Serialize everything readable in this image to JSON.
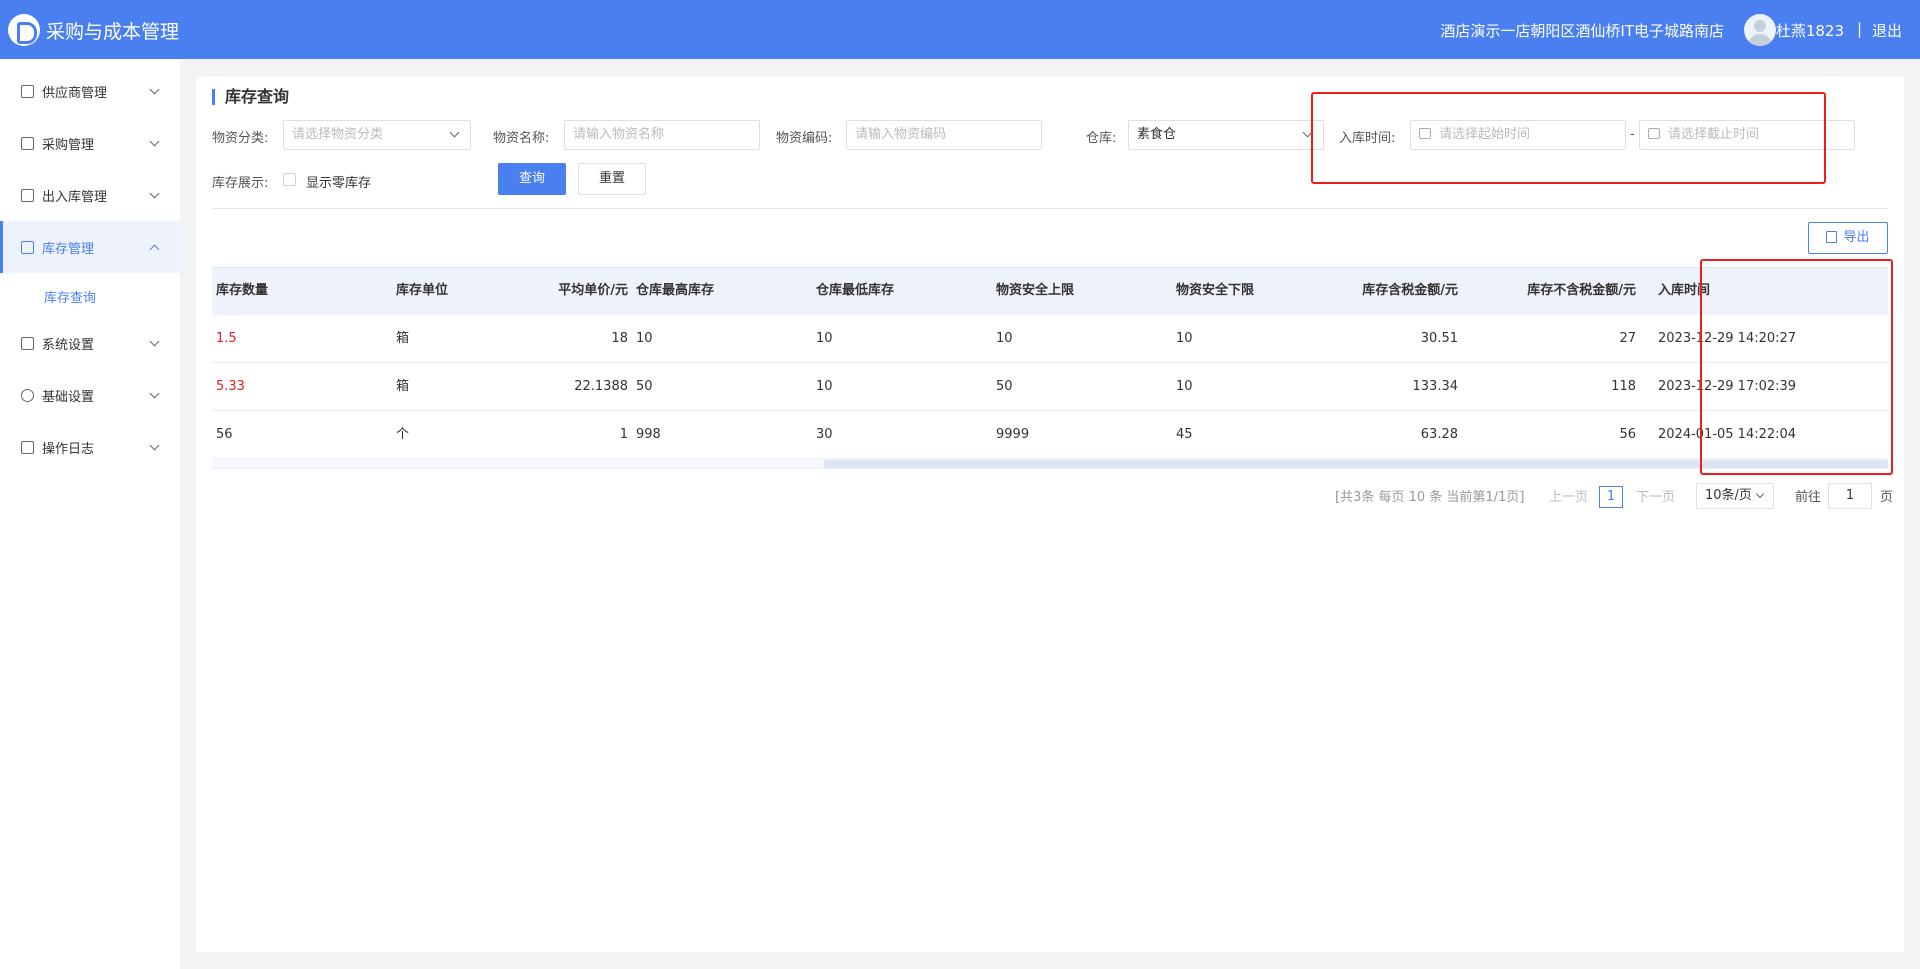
{
  "header": {
    "app_title": "采购与成本管理",
    "store_name": "酒店演示一店朝阳区酒仙桥IT电子城路南店",
    "user_name": "杜燕1823",
    "separator": "|",
    "logout": "退出"
  },
  "sidebar": {
    "items": [
      {
        "label": "供应商管理",
        "icon": "supplier-icon"
      },
      {
        "label": "采购管理",
        "icon": "purchase-icon"
      },
      {
        "label": "出入库管理",
        "icon": "inout-icon"
      },
      {
        "label": "库存管理",
        "icon": "inventory-icon",
        "active": true
      },
      {
        "label": "系统设置",
        "icon": "system-icon"
      },
      {
        "label": "基础设置",
        "icon": "gear-icon"
      },
      {
        "label": "操作日志",
        "icon": "log-icon"
      }
    ],
    "sub_item": "库存查询"
  },
  "page": {
    "title": "库存查询",
    "filters": {
      "category_label": "物资分类:",
      "category_placeholder": "请选择物资分类",
      "name_label": "物资名称:",
      "name_placeholder": "请输入物资名称",
      "code_label": "物资编码:",
      "code_placeholder": "请输入物资编码",
      "warehouse_label": "仓库:",
      "warehouse_value": "素食仓",
      "time_label": "入库时间:",
      "start_placeholder": "请选择起始时间",
      "range_sep": "-",
      "end_placeholder": "请选择截止时间",
      "display_label": "库存展示:",
      "zero_stock_label": "显示零库存",
      "zero_stock_checked": false
    },
    "buttons": {
      "query": "查询",
      "reset": "重置",
      "export": "导出"
    }
  },
  "table": {
    "columns": [
      "库存数量",
      "库存单位",
      "平均单价/元",
      "仓库最高库存",
      "仓库最低库存",
      "物资安全上限",
      "物资安全下限",
      "库存含税金额/元",
      "库存不含税金额/元",
      "入库时间"
    ],
    "rows": [
      [
        "1.5",
        "箱",
        "18",
        "10",
        "10",
        "10",
        "10",
        "30.51",
        "27",
        "2023-12-29 14:20:27"
      ],
      [
        "5.33",
        "箱",
        "22.1388",
        "50",
        "10",
        "50",
        "10",
        "133.34",
        "118",
        "2023-12-29 17:02:39"
      ],
      [
        "56",
        "个",
        "1",
        "998",
        "30",
        "9999",
        "45",
        "63.28",
        "56",
        "2024-01-05 14:22:04"
      ]
    ]
  },
  "pagination": {
    "summary": "[共3条 每页 10 条 当前第1/1页]",
    "prev": "上一页",
    "current": "1",
    "next": "下一页",
    "page_size": "10条/页",
    "goto_label": "前往",
    "goto_value": "1",
    "page_suffix": "页"
  },
  "colors": {
    "primary": "#4a7ff0",
    "highlight": "#ee1c1c",
    "low_stock": "#e02020"
  }
}
